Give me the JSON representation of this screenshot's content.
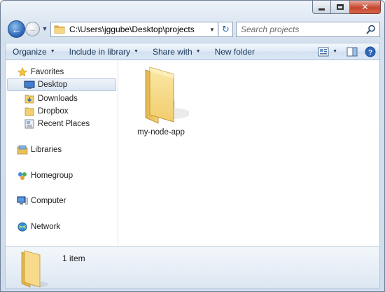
{
  "window": {
    "caption_buttons": {
      "minimize": "minimize",
      "maximize": "maximize",
      "close": "✕"
    }
  },
  "navigation": {
    "address_path": "C:\\Users\\jggube\\Desktop\\projects",
    "search_placeholder": "Search projects"
  },
  "command_bar": {
    "organize": "Organize",
    "include_in_library": "Include in library",
    "share_with": "Share with",
    "new_folder": "New folder"
  },
  "nav_pane": {
    "favorites": "Favorites",
    "favorites_items": [
      {
        "label": "Desktop",
        "selected": true
      },
      {
        "label": "Downloads"
      },
      {
        "label": "Dropbox"
      },
      {
        "label": "Recent Places"
      }
    ],
    "libraries": "Libraries",
    "homegroup": "Homegroup",
    "computer": "Computer",
    "network": "Network"
  },
  "files": [
    {
      "name": "my-node-app",
      "type": "folder"
    }
  ],
  "details": {
    "count": "1 item"
  },
  "colors": {
    "accent": "#2f67b8",
    "folder": "#f3d27a",
    "selection": "#dbe6f3"
  }
}
